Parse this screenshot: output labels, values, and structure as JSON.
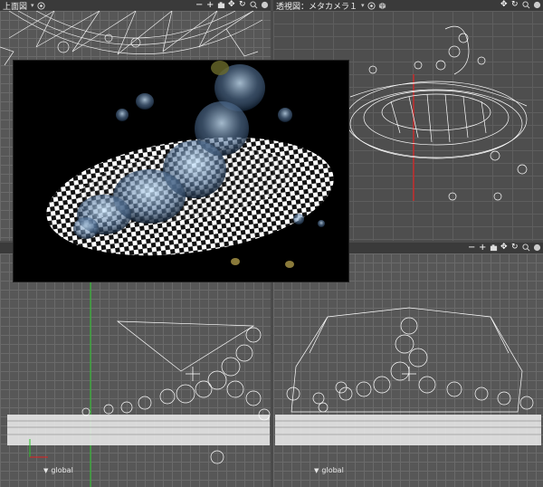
{
  "viewports": {
    "top": {
      "title": "上面図",
      "dropdown": "▾"
    },
    "perspective": {
      "title": "透視図：メタカメラ１",
      "dropdown": "▾"
    },
    "front": {
      "title": "",
      "global_label": "global"
    },
    "side": {
      "title": "",
      "global_label": "global"
    }
  },
  "controls": {
    "minus": "−",
    "plus": "+",
    "move": "✥",
    "rotate": "↻",
    "menu": "●"
  },
  "colors": {
    "grid_bg": "#575757",
    "grid_line": "#6a6a6a",
    "wire": "#ffffff",
    "axis_green": "#28c828",
    "axis_red": "#e02020"
  }
}
